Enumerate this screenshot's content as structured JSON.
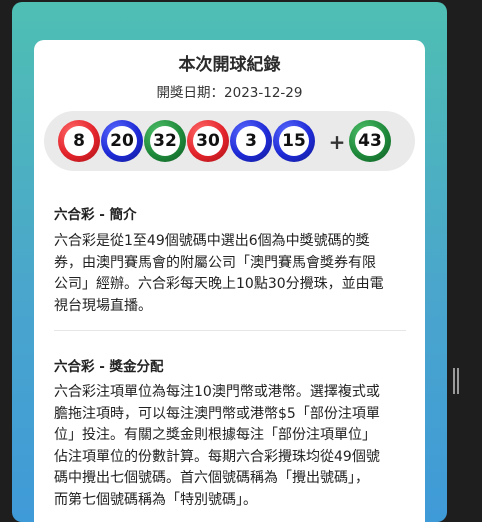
{
  "card": {
    "title": "本次開球紀錄",
    "date_label": "開獎日期：",
    "date_value": "2023-12-29"
  },
  "draw": {
    "balls": [
      {
        "number": "8",
        "color": "red"
      },
      {
        "number": "20",
        "color": "blue"
      },
      {
        "number": "32",
        "color": "green"
      },
      {
        "number": "30",
        "color": "red"
      },
      {
        "number": "3",
        "color": "blue"
      },
      {
        "number": "15",
        "color": "blue"
      }
    ],
    "plus": "+",
    "special": {
      "number": "43",
      "color": "green"
    }
  },
  "sections": [
    {
      "heading": "六合彩 - 簡介",
      "lines": [
        "六合彩是從1至49個號碼中選出6個為中獎號碼的獎",
        "券，由澳門賽馬會的附屬公司「澳門賽馬會獎券有限",
        "公司」經辦。六合彩每天晚上10點30分攪珠，並由電",
        "視台現場直播。"
      ]
    },
    {
      "heading": "六合彩 - 獎金分配",
      "lines": [
        "六合彩注項單位為每注10澳門幣或港幣。選擇複式或",
        "膽拖注項時，可以每注澳門幣或港幣$5「部份注項單",
        "位」投注。有關之獎金則根據每注「部份注項單位」",
        "佔注項單位的份數計算。每期六合彩攪珠均從49個號",
        "碼中攪出七個號碼。首六個號碼稱為「攪出號碼」，",
        "而第七個號碼稱為「特別號碼」。"
      ]
    }
  ],
  "colors": {
    "red": "#e3242b",
    "blue": "#1f2bd6",
    "green": "#1f8a3b",
    "background_top": "#4fbfb3",
    "background_bottom": "#3f9ad8"
  }
}
